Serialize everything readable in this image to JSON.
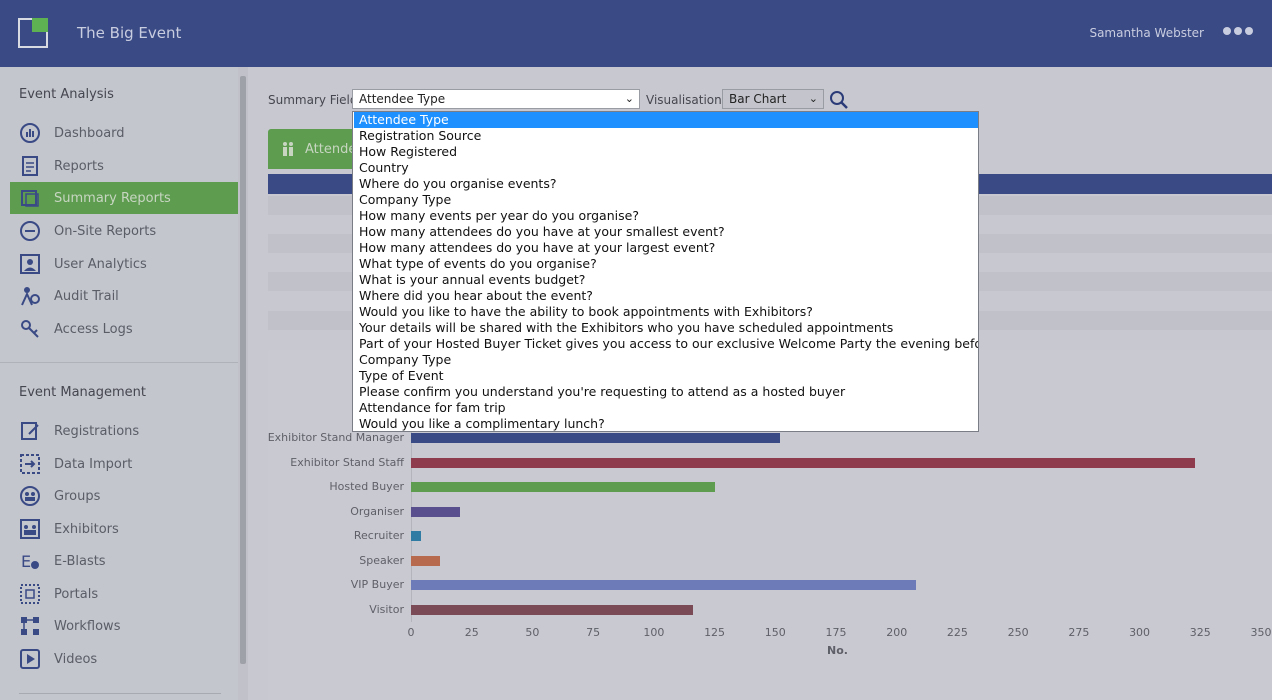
{
  "header": {
    "app_title": "The Big Event",
    "user_name": "Samantha Webster"
  },
  "sidebar": {
    "analysis_title": "Event Analysis",
    "analysis_items": [
      {
        "label": "Dashboard",
        "icon": "dashboard-icon"
      },
      {
        "label": "Reports",
        "icon": "reports-icon"
      },
      {
        "label": "Summary Reports",
        "icon": "summary-reports-icon"
      },
      {
        "label": "On-Site Reports",
        "icon": "on-site-reports-icon"
      },
      {
        "label": "User Analytics",
        "icon": "user-analytics-icon"
      },
      {
        "label": "Audit Trail",
        "icon": "audit-trail-icon"
      },
      {
        "label": "Access Logs",
        "icon": "access-logs-icon"
      }
    ],
    "management_title": "Event Management",
    "management_items": [
      {
        "label": "Registrations",
        "icon": "registrations-icon"
      },
      {
        "label": "Data Import",
        "icon": "data-import-icon"
      },
      {
        "label": "Groups",
        "icon": "groups-icon"
      },
      {
        "label": "Exhibitors",
        "icon": "exhibitors-icon"
      },
      {
        "label": "E-Blasts",
        "icon": "e-blasts-icon"
      },
      {
        "label": "Portals",
        "icon": "portals-icon"
      },
      {
        "label": "Workflows",
        "icon": "workflows-icon"
      },
      {
        "label": "Videos",
        "icon": "videos-icon"
      }
    ]
  },
  "controls": {
    "summary_field_label": "Summary Field",
    "summary_field_value": "Attendee Type",
    "visualisation_label": "Visualisation",
    "visualisation_value": "Bar Chart",
    "tab_label": "Attendee"
  },
  "dropdown": {
    "options": [
      "Attendee Type",
      "Registration Source",
      "How Registered",
      "Country",
      "Where do you organise events?",
      "Company Type",
      "How many events per year do you organise?",
      "How many attendees do you have at your smallest event?",
      "How many attendees do you have at your largest event?",
      "What type of events do you organise?",
      "What is your annual events budget?",
      "Where did you hear about the event?",
      "Would you like to have the ability to book appointments with Exhibitors?",
      "Your details will be shared with the Exhibitors who you have scheduled appointments",
      "Part of your Hosted Buyer Ticket gives you access to our exclusive Welcome Party the evening before the Show",
      "Company Type",
      "Type of Event",
      "Please confirm you understand you're requesting to attend as a hosted buyer",
      "Attendance for fam trip",
      "Would you like a complimentary lunch?"
    ],
    "selected_index": 0
  },
  "chart_data": {
    "type": "bar",
    "orientation": "horizontal",
    "categories": [
      "Exhibitor Stand Manager",
      "Exhibitor Stand Staff",
      "Hosted Buyer",
      "Organiser",
      "Recruiter",
      "Speaker",
      "VIP Buyer",
      "Visitor"
    ],
    "values": [
      152,
      323,
      125,
      20,
      4,
      12,
      208,
      116
    ],
    "colors": [
      "#3a4a85",
      "#8e3b4e",
      "#5e9d50",
      "#5a4f8e",
      "#2f7ba3",
      "#b86a4e",
      "#6d7bb8",
      "#7a4a57"
    ],
    "x_ticks": [
      "0",
      "25",
      "50",
      "75",
      "100",
      "125",
      "150",
      "175",
      "200",
      "225",
      "250",
      "275",
      "300",
      "325",
      "350"
    ],
    "xlim": [
      0,
      350
    ],
    "xlabel": "No.",
    "ylabel": ""
  }
}
